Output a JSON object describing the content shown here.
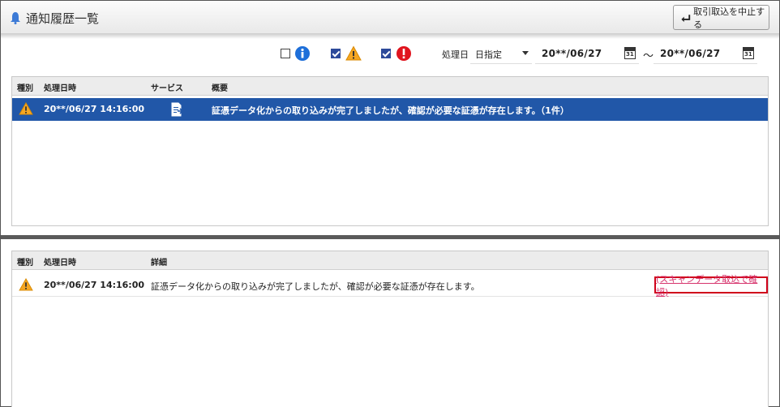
{
  "header": {
    "title": "通知履歴一覧",
    "stop_button_label": "取引取込を中止する"
  },
  "filter": {
    "info_checked": false,
    "warning_checked": true,
    "error_checked": true,
    "date_label": "処理日",
    "date_mode": "日指定",
    "date_from": "20**/06/27",
    "range_separator": "～",
    "date_to": "20**/06/27",
    "calendar_day": "31"
  },
  "notifications": {
    "columns": [
      "種別",
      "処理日時",
      "サービス",
      "概要"
    ],
    "rows": [
      {
        "type_icon": "warning-icon",
        "datetime": "20**/06/27 14:16:00",
        "service_icon": "document-import-icon",
        "summary": "証憑データ化からの取り込みが完了しましたが、確認が必要な証憑が存在します。（1件）",
        "selected": true
      }
    ]
  },
  "details": {
    "columns": [
      "種別",
      "処理日時",
      "詳細"
    ],
    "rows": [
      {
        "type_icon": "warning-icon",
        "datetime": "20**/06/27 14:16:00",
        "detail": "証憑データ化からの取り込みが完了しましたが、確認が必要な証憑が存在します。",
        "link": "(スキャンデータ取込で確認)"
      }
    ]
  },
  "colors": {
    "selected_row": "#2157a8",
    "link": "#d6336c",
    "highlight_border": "#d0021b",
    "info_icon": "#1e6fd9",
    "warning_icon": "#f5a623",
    "error_icon": "#e0141e"
  }
}
